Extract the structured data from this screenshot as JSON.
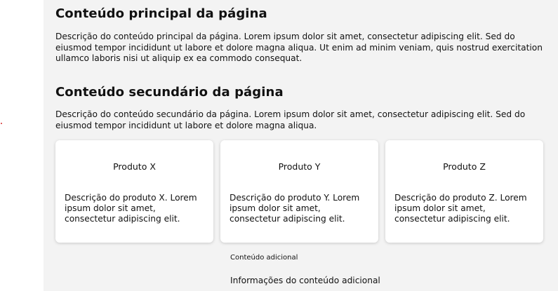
{
  "main_section": {
    "title": "Conteúdo principal da página",
    "description": "Descrição do conteúdo principal da página. Lorem ipsum dolor sit amet, consectetur adipiscing elit. Sed do eiusmod tempor incididunt ut labore et dolore magna aliqua. Ut enim ad minim veniam, quis nostrud exercitation ullamco laboris nisi ut aliquip ex ea commodo consequat."
  },
  "secondary_section": {
    "title": "Conteúdo secundário da página",
    "description": "Descrição do conteúdo secundário da página. Lorem ipsum dolor sit amet, consectetur adipiscing elit. Sed do eiusmod tempor incididunt ut labore et dolore magna aliqua."
  },
  "products": [
    {
      "name": "Produto X",
      "description": "Descrição do produto X. Lorem ipsum dolor sit amet, consectetur adipiscing elit."
    },
    {
      "name": "Produto Y",
      "description": "Descrição do produto Y. Lorem ipsum dolor sit amet, consectetur adipiscing elit."
    },
    {
      "name": "Produto Z",
      "description": "Descrição do produto Z. Lorem ipsum dolor sit amet, consectetur adipiscing elit."
    }
  ],
  "additional": {
    "title": "Conteúdo adicional",
    "info": "Informações do conteúdo adicional"
  },
  "colors": {
    "page_background": "#f3f3f3",
    "card_background": "#ffffff",
    "text": "#111111"
  }
}
